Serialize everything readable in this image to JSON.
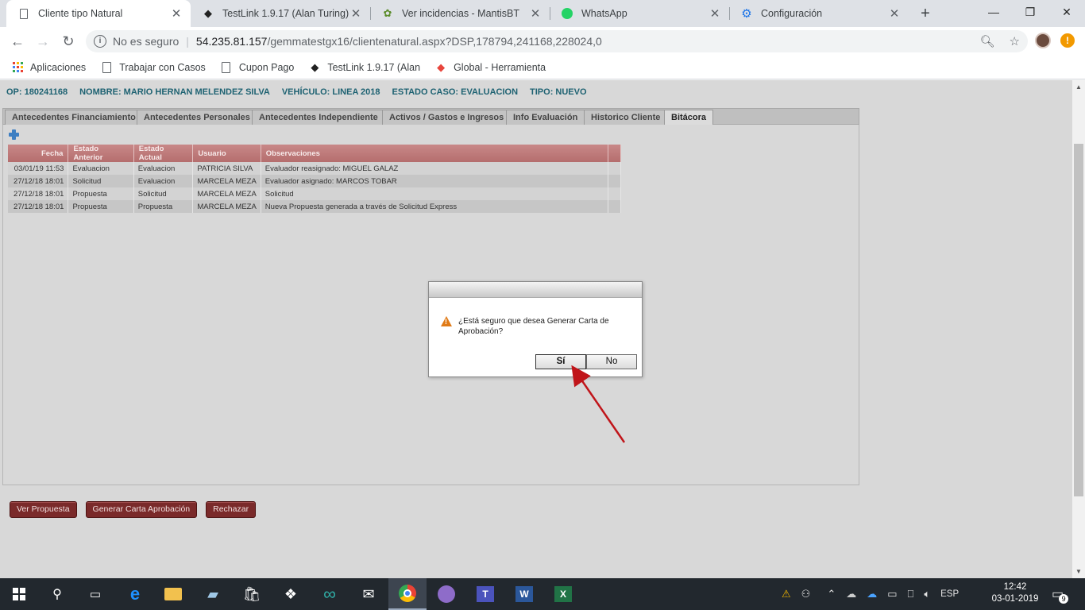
{
  "browser": {
    "tabs": [
      {
        "title": "Cliente tipo Natural",
        "icon": "page-icon",
        "active": true
      },
      {
        "title": "TestLink 1.9.17 (Alan Turing)",
        "icon": "testlink-icon",
        "active": false
      },
      {
        "title": "Ver incidencias - MantisBT",
        "icon": "mantis-icon",
        "active": false
      },
      {
        "title": "WhatsApp",
        "icon": "whatsapp-icon",
        "active": false
      },
      {
        "title": "Configuración",
        "icon": "gear-icon",
        "active": false
      }
    ],
    "address": {
      "security_label": "No es seguro",
      "host": "54.235.81.157",
      "path": "/gemmatestgx16/clientenatural.aspx?DSP,178794,241168,228024,0"
    },
    "bookmarks": [
      {
        "label": "Aplicaciones",
        "icon": "apps-icon"
      },
      {
        "label": "Trabajar con Casos",
        "icon": "page-icon"
      },
      {
        "label": "Cupon Pago",
        "icon": "page-icon"
      },
      {
        "label": "TestLink 1.9.17 (Alan",
        "icon": "testlink-icon"
      },
      {
        "label": "Global - Herramienta",
        "icon": "global-icon"
      }
    ],
    "alert_badge": "!"
  },
  "header": {
    "op": "OP: 180241168",
    "nombre": "NOMBRE: MARIO HERNAN MELENDEZ SILVA",
    "vehiculo": "VEHÍCULO: LINEA 2018",
    "estado": "ESTADO CASO: EVALUACION",
    "tipo": "TIPO: NUEVO"
  },
  "tabs": [
    {
      "label": "Antecedentes Financiamiento"
    },
    {
      "label": "Antecedentes Personales"
    },
    {
      "label": "Antecedentes Independiente"
    },
    {
      "label": "Activos / Gastos e Ingresos"
    },
    {
      "label": "Info Evaluación"
    },
    {
      "label": "Historico Cliente"
    },
    {
      "label": "Bitácora"
    }
  ],
  "table": {
    "columns": [
      "Fecha",
      "Estado Anterior",
      "Estado Actual",
      "Usuario",
      "Observaciones"
    ],
    "rows": [
      [
        "03/01/19 11:53",
        "Evaluacion",
        "Evaluacion",
        "PATRICIA SILVA",
        "Evaluador reasignado: MIGUEL GALAZ"
      ],
      [
        "27/12/18 18:01",
        "Solicitud",
        "Evaluacion",
        "MARCELA MEZA",
        "Evaluador asignado: MARCOS TOBAR"
      ],
      [
        "27/12/18 18:01",
        "Propuesta",
        "Solicitud",
        "MARCELA MEZA",
        "Solicitud"
      ],
      [
        "27/12/18 18:01",
        "Propuesta",
        "Propuesta",
        "MARCELA MEZA",
        "Nueva Propuesta generada a través de Solicitud Express"
      ]
    ]
  },
  "actions": {
    "ver_propuesta": "Ver Propuesta",
    "generar_carta": "Generar Carta Aprobación",
    "rechazar": "Rechazar"
  },
  "dialog": {
    "message": "¿Está seguro que desea Generar Carta de Aprobación?",
    "yes": "Sí",
    "no": "No"
  },
  "taskbar": {
    "language": "ESP",
    "time": "12:42",
    "date": "03-01-2019",
    "notifications": "9"
  },
  "colors": {
    "header_text": "#1e6272",
    "action_button": "#7a2a2a",
    "table_header": "#b56e6e",
    "annotation_arrow": "#c0151a"
  }
}
